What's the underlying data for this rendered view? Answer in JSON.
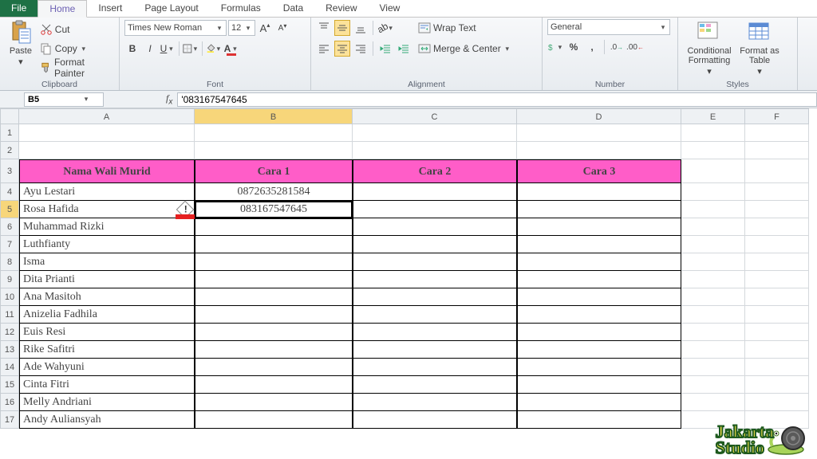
{
  "tabs": {
    "file": "File",
    "home": "Home",
    "insert": "Insert",
    "pageLayout": "Page Layout",
    "formulas": "Formulas",
    "data": "Data",
    "review": "Review",
    "view": "View"
  },
  "clipboard": {
    "paste": "Paste",
    "cut": "Cut",
    "copy": "Copy",
    "formatPainter": "Format Painter",
    "group": "Clipboard"
  },
  "font": {
    "name": "Times New Roman",
    "size": "12",
    "group": "Font"
  },
  "alignment": {
    "wrap": "Wrap Text",
    "merge": "Merge & Center",
    "group": "Alignment"
  },
  "number": {
    "format": "General",
    "group": "Number"
  },
  "styles": {
    "cond": "Conditional Formatting",
    "table": "Format as Table",
    "group": "Styles"
  },
  "namebox": "B5",
  "formula": "'083167547645",
  "columns": [
    "A",
    "B",
    "C",
    "D",
    "E",
    "F"
  ],
  "headerRow": {
    "a": "Nama Wali Murid",
    "b": "Cara 1",
    "c": "Cara 2",
    "d": "Cara 3"
  },
  "rows": [
    {
      "n": "1"
    },
    {
      "n": "2"
    },
    {
      "n": "3",
      "a": "Nama Wali Murid",
      "b": "Cara 1",
      "c": "Cara 2",
      "d": "Cara 3",
      "hdr": true
    },
    {
      "n": "4",
      "a": "Ayu Lestari",
      "b": "0872635281584"
    },
    {
      "n": "5",
      "a": "Rosa Hafida",
      "b": "083167547645",
      "sel": true
    },
    {
      "n": "6",
      "a": "Muhammad Rizki"
    },
    {
      "n": "7",
      "a": "Luthfianty"
    },
    {
      "n": "8",
      "a": "Isma"
    },
    {
      "n": "9",
      "a": "Dita Prianti"
    },
    {
      "n": "10",
      "a": "Ana Masitoh"
    },
    {
      "n": "11",
      "a": "Anizelia Fadhila"
    },
    {
      "n": "12",
      "a": "Euis Resi"
    },
    {
      "n": "13",
      "a": "Rike Safitri"
    },
    {
      "n": "14",
      "a": "Ade Wahyuni"
    },
    {
      "n": "15",
      "a": "Cinta Fitri"
    },
    {
      "n": "16",
      "a": "Melly Andriani"
    },
    {
      "n": "17",
      "a": "Andy Auliansyah"
    }
  ],
  "watermark": "Jakarta\nStudio"
}
